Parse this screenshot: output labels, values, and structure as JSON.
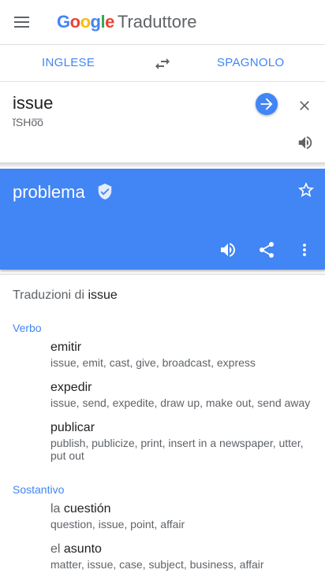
{
  "header": {
    "brand_google": "Google",
    "brand_app": "Traduttore"
  },
  "languages": {
    "source": "INGLESE",
    "target": "SPAGNOLO"
  },
  "input": {
    "text": "issue",
    "transliteration": "ĭSHo͞o"
  },
  "result": {
    "text": "problema"
  },
  "dictionary": {
    "title_prefix": "Traduzioni di",
    "title_word": "issue",
    "sections": [
      {
        "pos": "Verbo",
        "entries": [
          {
            "article": "",
            "word": "emitir",
            "synonyms": "issue, emit, cast, give, broadcast, express"
          },
          {
            "article": "",
            "word": "expedir",
            "synonyms": "issue, send, expedite, draw up, make out, send away"
          },
          {
            "article": "",
            "word": "publicar",
            "synonyms": "publish, publicize, print, insert in a newspaper, utter, put out"
          }
        ]
      },
      {
        "pos": "Sostantivo",
        "entries": [
          {
            "article": "la",
            "word": "cuestión",
            "synonyms": "question, issue, point, affair"
          },
          {
            "article": "el",
            "word": "asunto",
            "synonyms": "matter, issue, case, subject, business, affair"
          }
        ]
      }
    ]
  },
  "colors": {
    "accent": "#4285f4",
    "google_blue": "#4285f4",
    "google_red": "#ea4335",
    "google_yellow": "#fbbc05",
    "google_green": "#34a853"
  }
}
